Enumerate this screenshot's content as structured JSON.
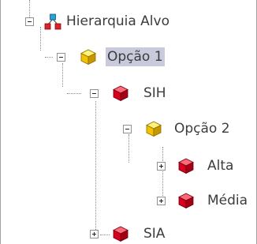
{
  "tree": {
    "nodes": [
      {
        "id": "hierarquia-alvo",
        "label": "Hierarquia Alvo",
        "icon": "hierarchy-icon",
        "expanded": true,
        "selected": false
      },
      {
        "id": "opcao-1",
        "label": "Opção 1",
        "icon": "yellow-cube-icon",
        "expanded": true,
        "selected": true
      },
      {
        "id": "sih",
        "label": "SIH",
        "icon": "red-cube-icon",
        "expanded": true,
        "selected": false
      },
      {
        "id": "opcao-2",
        "label": "Opção 2",
        "icon": "yellow-cube-icon",
        "expanded": true,
        "selected": false
      },
      {
        "id": "alta",
        "label": "Alta",
        "icon": "red-cube-icon",
        "expanded": false,
        "selected": false
      },
      {
        "id": "media",
        "label": "Média",
        "icon": "red-cube-icon",
        "expanded": false,
        "selected": false
      },
      {
        "id": "sia",
        "label": "SIA",
        "icon": "red-cube-icon",
        "expanded": false,
        "selected": false
      }
    ]
  },
  "colors": {
    "selection": "#c9cbdc",
    "text": "#3c3c3c",
    "yellow_cube": "#f2c200",
    "red_cube": "#d6001c"
  }
}
